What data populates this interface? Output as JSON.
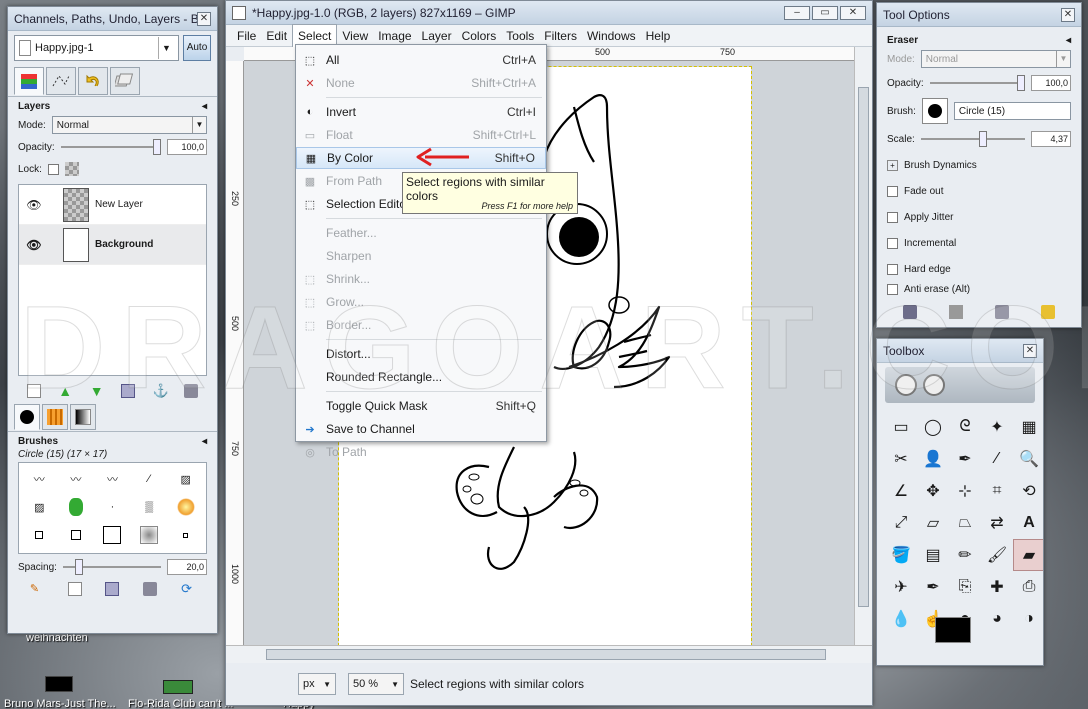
{
  "desktop": {
    "labels": [
      "weihnachten",
      "Bruno Mars-Just The...",
      "Flo-Rida Club can't ...",
      "Happy"
    ]
  },
  "left_dock": {
    "title": "Channels, Paths, Undo, Layers - B...",
    "image_select": "Happy.jpg-1",
    "auto_label": "Auto",
    "layers": {
      "title": "Layers",
      "mode_label": "Mode:",
      "mode_value": "Normal",
      "opacity_label": "Opacity:",
      "opacity_value": "100,0",
      "opacity_fraction": 1.0,
      "lock_label": "Lock:",
      "items": [
        {
          "name": "New Layer",
          "visible": true
        },
        {
          "name": "Background",
          "visible": true
        }
      ]
    },
    "brushes": {
      "title": "Brushes",
      "current": "Circle (15) (17 × 17)",
      "spacing_label": "Spacing:",
      "spacing_value": "20,0",
      "spacing_fraction": 0.2
    }
  },
  "gimp": {
    "title": "*Happy.jpg-1.0 (RGB, 2 layers) 827x1169 – GIMP",
    "menu": [
      "File",
      "Edit",
      "Select",
      "View",
      "Image",
      "Layer",
      "Colors",
      "Tools",
      "Filters",
      "Windows",
      "Help"
    ],
    "ruler_marks": [
      "500",
      "750"
    ],
    "ruler_left_marks": [
      "250",
      "500",
      "750",
      "1000"
    ],
    "unit": "px",
    "zoom": "50 %",
    "status_text": "Select regions with similar colors"
  },
  "select_menu": {
    "items": [
      {
        "label": "All",
        "shortcut": "Ctrl+A",
        "enabled": true,
        "icon": "select-all-icon"
      },
      {
        "label": "None",
        "shortcut": "Shift+Ctrl+A",
        "enabled": false,
        "icon": "select-none-icon"
      },
      {
        "label": "Invert",
        "shortcut": "Ctrl+I",
        "enabled": true,
        "icon": "invert-icon"
      },
      {
        "label": "Float",
        "shortcut": "Shift+Ctrl+L",
        "enabled": false,
        "icon": "float-icon"
      },
      {
        "label": "By Color",
        "shortcut": "Shift+O",
        "enabled": true,
        "highlighted": true,
        "icon": "by-color-icon"
      },
      {
        "label": "From Path",
        "shortcut": "",
        "enabled": false,
        "icon": "from-path-icon"
      },
      {
        "label": "Selection Editor",
        "shortcut": "",
        "enabled": true,
        "icon": "selection-editor-icon"
      },
      {
        "label": "Feather...",
        "shortcut": "",
        "enabled": false,
        "icon": ""
      },
      {
        "label": "Sharpen",
        "shortcut": "",
        "enabled": false,
        "icon": ""
      },
      {
        "label": "Shrink...",
        "shortcut": "",
        "enabled": false,
        "icon": "shrink-icon"
      },
      {
        "label": "Grow...",
        "shortcut": "",
        "enabled": false,
        "icon": "grow-icon"
      },
      {
        "label": "Border...",
        "shortcut": "",
        "enabled": false,
        "icon": "border-icon"
      },
      {
        "label": "Distort...",
        "shortcut": "",
        "enabled": true,
        "icon": ""
      },
      {
        "label": "Rounded Rectangle...",
        "shortcut": "",
        "enabled": true,
        "icon": ""
      },
      {
        "label": "Toggle Quick Mask",
        "shortcut": "Shift+Q",
        "enabled": true,
        "icon": ""
      },
      {
        "label": "Save to Channel",
        "shortcut": "",
        "enabled": true,
        "icon": "save-channel-icon"
      },
      {
        "label": "To Path",
        "shortcut": "",
        "enabled": false,
        "icon": "to-path-icon"
      }
    ],
    "tooltip": "Select regions with similar colors",
    "tooltip_hint": "Press F1 for more help"
  },
  "tool_options": {
    "title": "Tool Options",
    "tool": "Eraser",
    "mode_label": "Mode:",
    "mode_value": "Normal",
    "opacity_label": "Opacity:",
    "opacity_value": "100,0",
    "opacity_fraction": 1.0,
    "brush_label": "Brush:",
    "brush_value": "Circle (15)",
    "scale_label": "Scale:",
    "scale_value": "4,37",
    "dynamics_label": "Brush Dynamics",
    "checks": [
      "Fade out",
      "Apply Jitter",
      "Incremental",
      "Hard edge",
      "Anti erase  (Alt)"
    ]
  },
  "toolbox": {
    "title": "Toolbox",
    "tools": [
      "rect-select-icon",
      "ellipse-select-icon",
      "lasso-icon",
      "fuzzy-select-icon",
      "by-color-select-icon",
      "scissors-icon",
      "foreground-select-icon",
      "paths-icon",
      "color-picker-icon",
      "zoom-icon",
      "measure-icon",
      "move-icon",
      "align-icon",
      "crop-icon",
      "rotate-icon",
      "scale-icon",
      "shear-icon",
      "perspective-icon",
      "flip-icon",
      "text-icon",
      "bucket-fill-icon",
      "blend-icon",
      "pencil-icon",
      "paintbrush-icon",
      "eraser-icon",
      "airbrush-icon",
      "ink-icon",
      "clone-icon",
      "heal-icon",
      "perspective-clone-icon",
      "blur-icon",
      "smudge-icon",
      "dodge-burn-icon",
      "color-balance-icon",
      "levels-icon"
    ],
    "active_tool": "eraser-icon"
  },
  "colors": {
    "accent": "#3c7fc4",
    "annotation_arrow": "#e02020",
    "tooltip_bg": "#ffffe1"
  },
  "watermark": "DRAGOART.COM"
}
